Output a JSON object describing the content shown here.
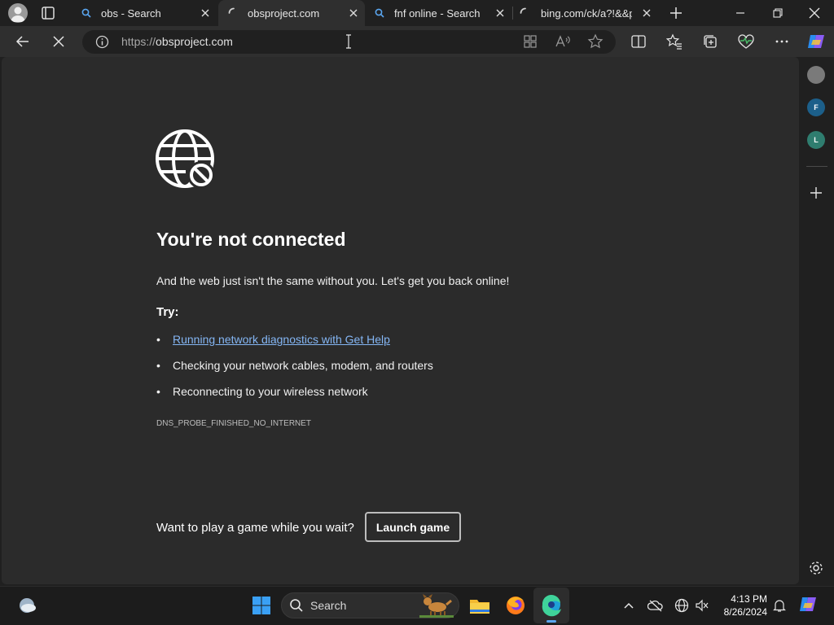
{
  "browser": {
    "tabs": [
      {
        "title": "obs - Search",
        "icon": "search-icon",
        "active": false
      },
      {
        "title": "obsproject.com",
        "icon": "loading-spinner-icon",
        "active": true
      },
      {
        "title": "fnf online - Search",
        "icon": "search-icon",
        "active": false
      },
      {
        "title": "bing.com/ck/a?!&&p",
        "icon": "loading-spinner-icon",
        "active": false
      }
    ],
    "address": {
      "protocol": "https://",
      "host": "obsproject.com"
    },
    "window_controls": [
      "minimize-icon",
      "restore-icon",
      "close-icon"
    ]
  },
  "error_page": {
    "heading": "You're not connected",
    "subtext": "And the web just isn't the same without you. Let's get you back online!",
    "try_label": "Try:",
    "suggestions": [
      "Running network diagnostics with Get Help",
      "Checking your network cables, modem, and routers",
      "Reconnecting to your wireless network"
    ],
    "error_code": "DNS_PROBE_FINISHED_NO_INTERNET",
    "game_prompt": "Want to play a game while you wait?",
    "launch_button": "Launch game"
  },
  "sidebar": {
    "items": [
      {
        "label": "",
        "icon": "circle-icon",
        "color": "#7a7a7a"
      },
      {
        "label": "F",
        "icon": "profile-f-icon",
        "color": "#1c5f8a"
      },
      {
        "label": "L",
        "icon": "profile-l-icon",
        "color": "#2f7d6f"
      }
    ]
  },
  "taskbar": {
    "search_label": "Search",
    "time": "4:13 PM",
    "date": "8/26/2024"
  },
  "colors": {
    "link": "#84b6f4",
    "content_bg": "#2b2b2b",
    "chrome_bg": "#202020",
    "toolbar_bg": "#2f2f2f"
  }
}
